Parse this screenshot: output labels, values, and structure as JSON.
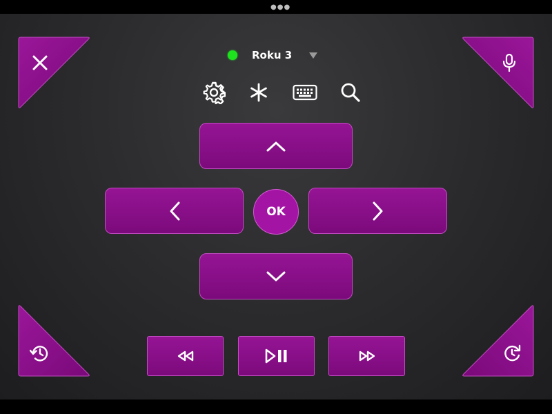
{
  "device": {
    "name": "Roku 3",
    "status": "connected",
    "status_color": "#1fe21f"
  },
  "ok_label": "OK",
  "theme": {
    "accent": "#8e1190",
    "background": "#2c2c2e"
  },
  "icons": {
    "close": "close-icon",
    "microphone": "microphone-icon",
    "settings": "gear-icon",
    "options": "asterisk-icon",
    "keyboard": "keyboard-icon",
    "search": "search-icon",
    "back": "history-icon",
    "replay": "replay-icon",
    "up": "chevron-up-icon",
    "down": "chevron-down-icon",
    "left": "chevron-left-icon",
    "right": "chevron-right-icon",
    "rewind": "rewind-icon",
    "play_pause": "play-pause-icon",
    "fast_forward": "fast-forward-icon",
    "caret": "caret-down-icon"
  }
}
